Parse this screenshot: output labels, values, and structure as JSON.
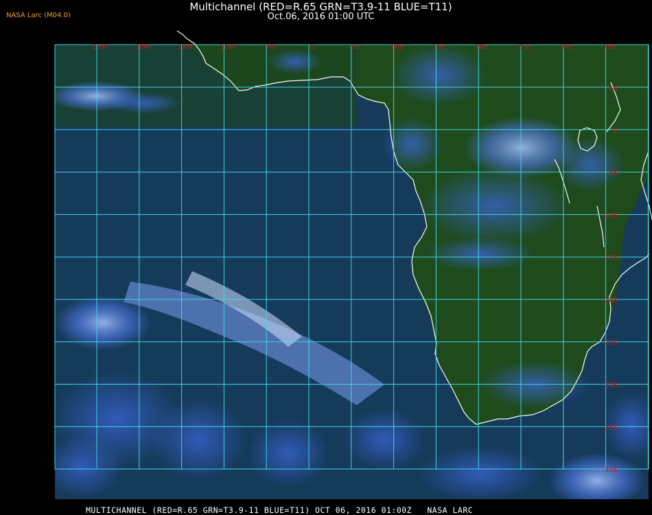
{
  "header": {
    "source": "NASA Larc (M04.0)",
    "title": "Multichannel (RED=R.65 GRN=T3.9-11 BLUE=T11)",
    "subtitle": "Oct.06, 2016 01:00 UTC"
  },
  "footer": {
    "text": "MULTICHANNEL (RED=R.65 GRN=T3.9-11 BLUE=T11) OCT 06, 2016 01:00Z   NASA LARC"
  },
  "map": {
    "lon_labels": [
      "25W",
      "20W",
      "15W",
      "10W",
      "5W",
      "0",
      "5E",
      "10E",
      "15E",
      "20E",
      "25E",
      "30E",
      "35E"
    ],
    "lat_labels": [
      "5N",
      "0",
      "5S",
      "10S",
      "15S",
      "20S",
      "25S",
      "30S",
      "35S",
      "40S"
    ],
    "colors": {
      "ocean": "#163a5a",
      "land": "#1e4a1c",
      "cloud": "#4a74e0",
      "cloud_bright": "#a8c4ff",
      "grid": "#3fd8e8",
      "labels": "#c81818",
      "coast": "#ffffff"
    }
  }
}
